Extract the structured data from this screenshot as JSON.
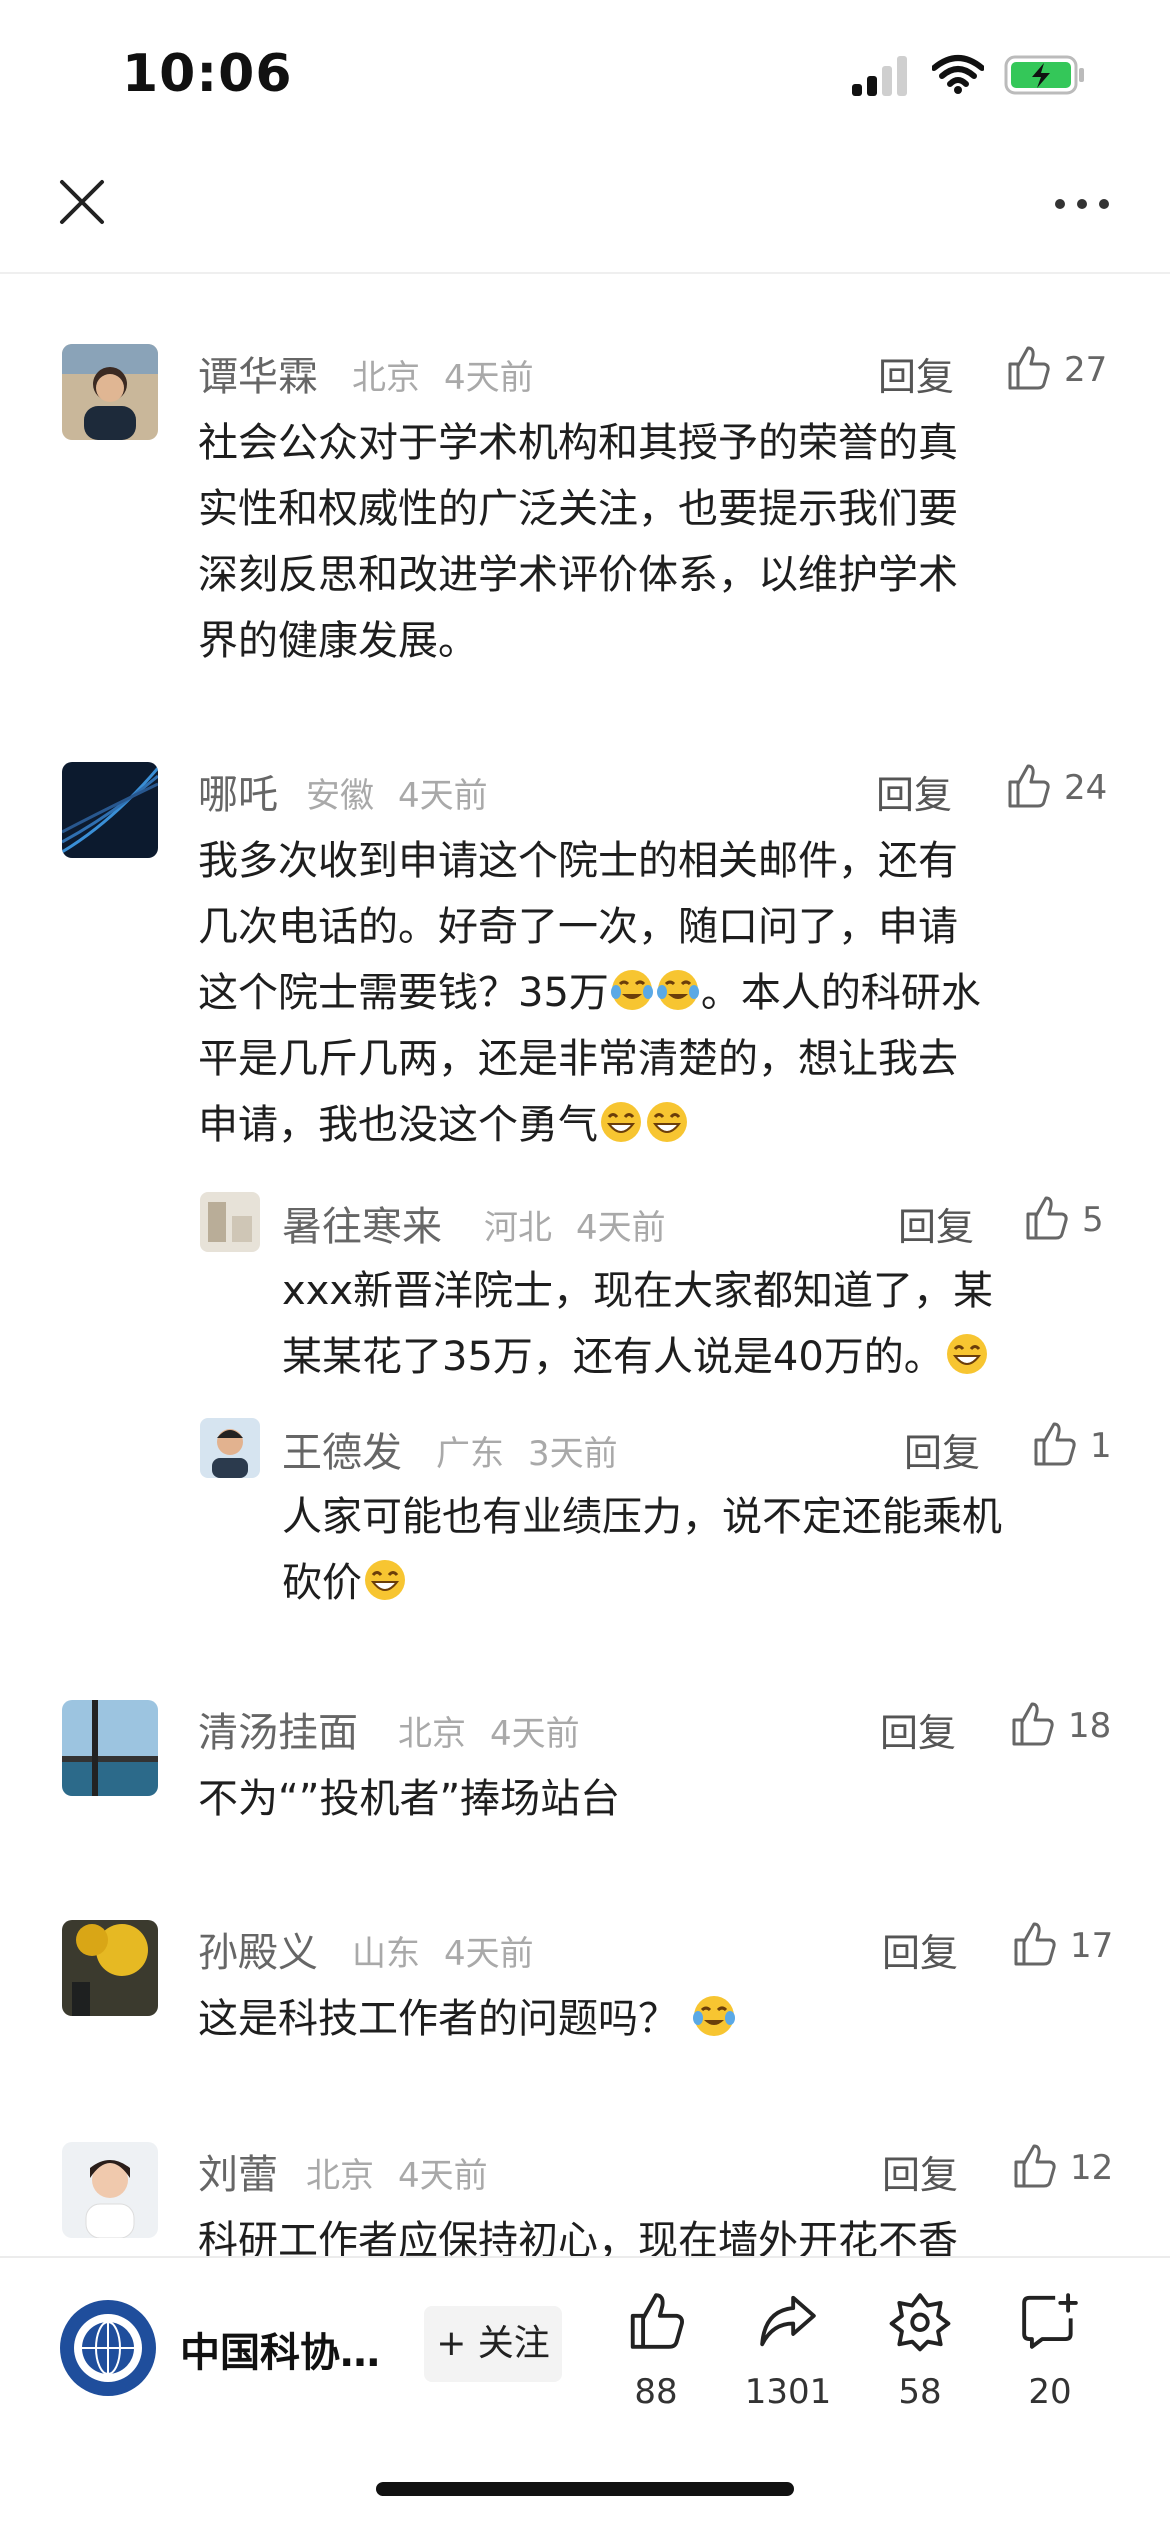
{
  "status_bar": {
    "time": "10:06",
    "battery_color": "#34c759"
  },
  "header": {
    "close_icon": "close-icon",
    "more_icon": "more-icon"
  },
  "comments": [
    {
      "name": "谭华霖",
      "location": "北京",
      "time": "4天前",
      "reply": "回复",
      "likes": "27",
      "lines": [
        "社会公众对于学术机构和其授予的荣誉的真",
        "实性和权威性的广泛关注，也要提示我们要",
        "深刻反思和改进学术评价体系，以维护学术",
        "界的健康发展。"
      ]
    },
    {
      "name": "哪吒",
      "location": "安徽",
      "time": "4天前",
      "reply": "回复",
      "likes": "24",
      "lines": [
        "我多次收到申请这个院士的相关邮件，还有",
        "几次电话的。好奇了一次，随口问了，申请",
        "这个院士需要钱？35万",
        "。本人的科研水",
        "平是几斤几两，还是非常清楚的，想让我去",
        "申请，我也没这个勇气"
      ]
    },
    {
      "name": "暑往寒来",
      "location": "河北",
      "time": "4天前",
      "reply": "回复",
      "likes": "5",
      "lines": [
        "xxx新晋洋院士，现在大家都知道了，某",
        "某某花了35万，还有人说是40万的。"
      ]
    },
    {
      "name": "王德发",
      "location": "广东",
      "time": "3天前",
      "reply": "回复",
      "likes": "1",
      "lines": [
        "人家可能也有业绩压力，说不定还能乘机",
        "砍价"
      ]
    },
    {
      "name": "清汤挂面",
      "location": "北京",
      "time": "4天前",
      "reply": "回复",
      "likes": "18",
      "lines": [
        "不为“”投机者”捧场站台"
      ]
    },
    {
      "name": "孙殿义",
      "location": "山东",
      "time": "4天前",
      "reply": "回复",
      "likes": "17",
      "lines": [
        "这是科技工作者的问题吗？"
      ]
    },
    {
      "name": "刘蕾",
      "location": "北京",
      "time": "4天前",
      "reply": "回复",
      "likes": "12",
      "lines": [
        "科研工作者应保持初心，现在墙外开花不香"
      ]
    }
  ],
  "bottom_bar": {
    "channel_name": "中国科协…",
    "follow_label": "+ 关注",
    "like_count": "88",
    "share_count": "1301",
    "collect_count": "58",
    "comment_count": "20"
  },
  "colors": {
    "accent_blue": "#1f4e9c",
    "text": "#1e1e1e",
    "meta": "#a9a9a9"
  }
}
